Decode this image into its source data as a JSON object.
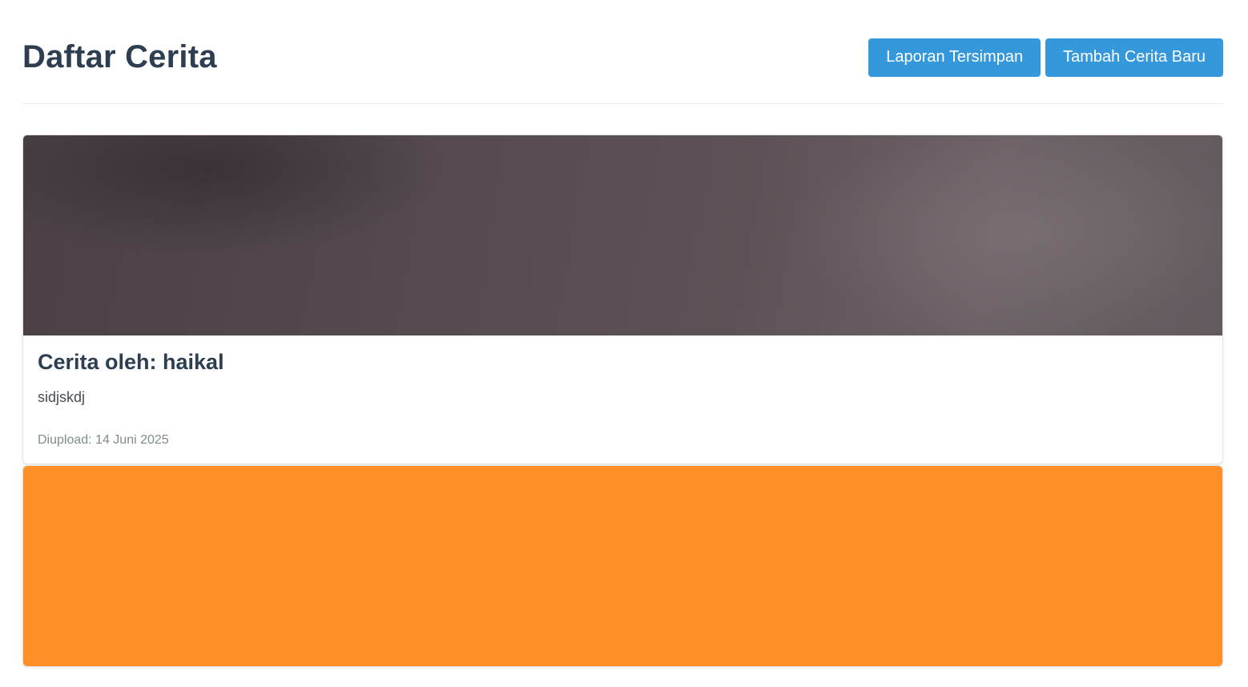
{
  "header": {
    "title": "Daftar Cerita",
    "saved_reports_label": "Laporan Tersimpan",
    "add_story_label": "Tambah Cerita Baru"
  },
  "stories": [
    {
      "title": "Cerita oleh: haikal",
      "description": "sidjskdj",
      "date": "Diupload: 14 Juni 2025",
      "image_color": "#5a5055"
    },
    {
      "image_color": "#ff8f26"
    }
  ],
  "colors": {
    "primary": "#3498db",
    "heading": "#2c3e50",
    "muted": "#7f8c8d"
  }
}
